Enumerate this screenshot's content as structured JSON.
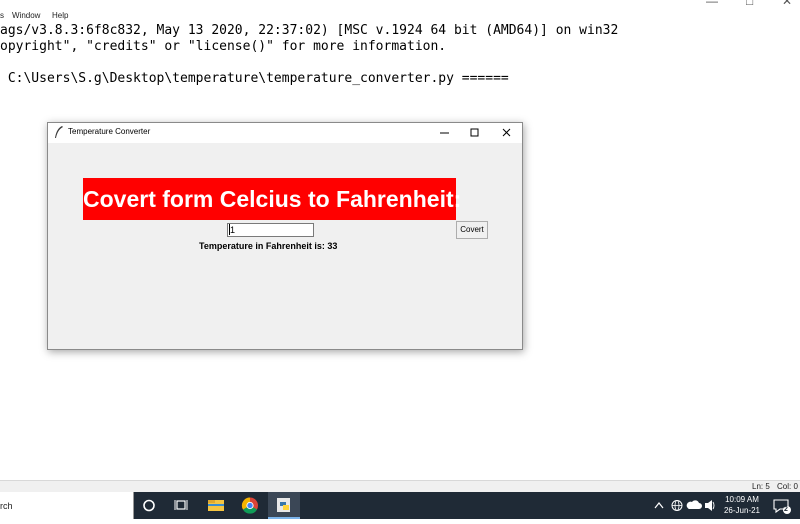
{
  "shell": {
    "menu": [
      "s",
      "Window",
      "Help"
    ],
    "lines": [
      "ags/v3.8.3:6f8c832, May 13 2020, 22:37:02) [MSC v.1924 64 bit (AMD64)] on win32",
      "opyright\", \"credits\" or \"license()\" for more information.",
      " C:\\Users\\S.g\\Desktop\\temperature\\temperature_converter.py ======"
    ],
    "status": {
      "line": "Ln: 5",
      "col": "Col: 0"
    }
  },
  "window": {
    "title": "Temperature Converter",
    "heading": "Covert form Celcius to Fahrenheit:",
    "entry_value": "1",
    "button_label": "Covert",
    "result_text": "Temperature in Fahrenheit is: 33"
  },
  "taskbar": {
    "search_text": "rch",
    "time": "10:09 AM",
    "date": "26-Jun-21",
    "notification_count": "2",
    "icons": [
      "cortana-icon",
      "task-view-icon",
      "file-explorer-icon",
      "chrome-icon",
      "python-idle-icon"
    ]
  }
}
